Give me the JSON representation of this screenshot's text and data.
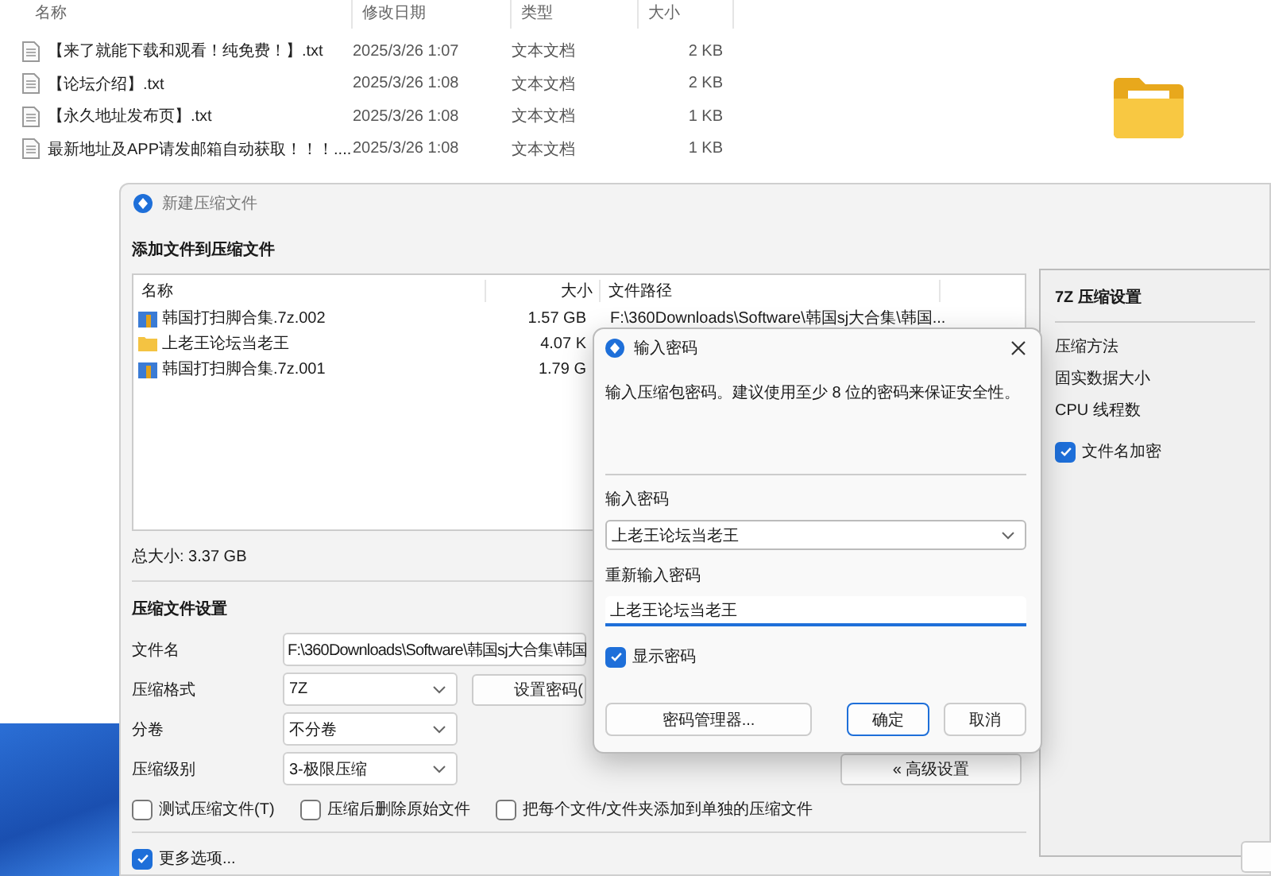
{
  "explorer": {
    "columns": [
      "名称",
      "修改日期",
      "类型",
      "大小"
    ],
    "files": [
      {
        "name": "【来了就能下载和观看！纯免费！】.txt",
        "date": "2025/3/26 1:07",
        "type": "文本文档",
        "size": "2 KB"
      },
      {
        "name": "【论坛介绍】.txt",
        "date": "2025/3/26 1:08",
        "type": "文本文档",
        "size": "2 KB"
      },
      {
        "name": "【永久地址发布页】.txt",
        "date": "2025/3/26 1:08",
        "type": "文本文档",
        "size": "1 KB"
      },
      {
        "name": "最新地址及APP请发邮箱自动获取！！！....",
        "date": "2025/3/26 1:08",
        "type": "文本文档",
        "size": "1 KB"
      }
    ]
  },
  "compress_dialog": {
    "title": "新建压缩文件",
    "section_title": "添加文件到压缩文件",
    "file_list": {
      "columns": [
        "名称",
        "大小",
        "文件路径"
      ],
      "rows": [
        {
          "kind": "archive",
          "name": "韩国打扫脚合集.7z.002",
          "size": "1.57 GB",
          "path": "F:\\360Downloads\\Software\\韩国sj大合集\\韩国..."
        },
        {
          "kind": "folder",
          "name": "上老王论坛当老王",
          "size": "4.07 K"
        },
        {
          "kind": "archive",
          "name": "韩国打扫脚合集.7z.001",
          "size": "1.79 G"
        }
      ]
    },
    "total_size": "总大小: 3.37 GB",
    "settings_title": "压缩文件设置",
    "fields": [
      {
        "kind": "text",
        "label": "文件名",
        "value": "F:\\360Downloads\\Software\\韩国sj大合集\\韩国"
      },
      {
        "kind": "select",
        "label": "压缩格式",
        "value": "7Z"
      },
      {
        "kind": "select",
        "label": "分卷",
        "value": "不分卷"
      },
      {
        "kind": "select",
        "label": "压缩级别",
        "value": "3-极限压缩"
      }
    ],
    "set_password_button": "设置密码(",
    "advanced_button": "« 高级设置",
    "options": [
      {
        "label": "测试压缩文件(T)",
        "checked": false
      },
      {
        "label": "压缩后删除原始文件",
        "checked": false
      },
      {
        "label": "把每个文件/文件夹添加到单独的压缩文件",
        "checked": false
      }
    ],
    "more_options": {
      "label": "更多选项...",
      "checked": true
    },
    "side_panel": {
      "title": "7Z 压缩设置",
      "items": [
        "压缩方法",
        "固实数据大小",
        "CPU 线程数"
      ],
      "encrypt_names": {
        "label": "文件名加密",
        "checked": true
      }
    }
  },
  "password_dialog": {
    "title": "输入密码",
    "hint": "输入压缩包密码。建议使用至少 8 位的密码来保证安全性。",
    "password_label": "输入密码",
    "password_value": "上老王论坛当老王",
    "reenter_label": "重新输入密码",
    "reenter_value": "上老王论坛当老王",
    "show_password": {
      "label": "显示密码",
      "checked": true
    },
    "buttons": [
      {
        "label": "密码管理器...",
        "kind": "normal"
      },
      {
        "label": "确定",
        "kind": "default"
      },
      {
        "label": "取消",
        "kind": "normal"
      }
    ]
  }
}
